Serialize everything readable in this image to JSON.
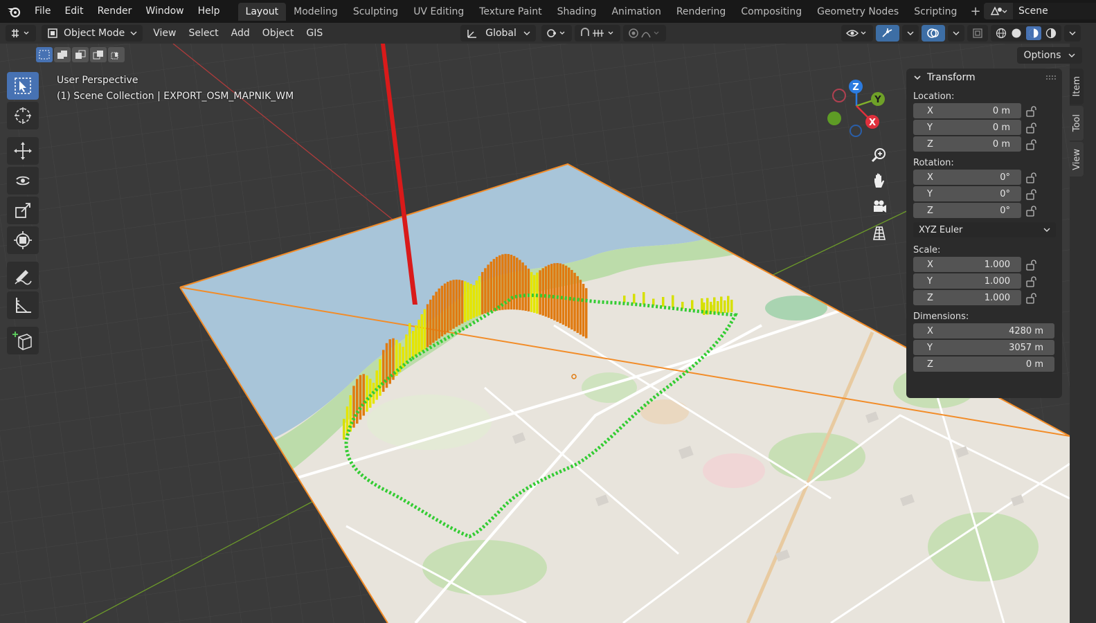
{
  "topbar": {
    "menus": [
      "File",
      "Edit",
      "Render",
      "Window",
      "Help"
    ],
    "workspaces": [
      "Layout",
      "Modeling",
      "Sculpting",
      "UV Editing",
      "Texture Paint",
      "Shading",
      "Animation",
      "Rendering",
      "Compositing",
      "Geometry Nodes",
      "Scripting"
    ],
    "add": "+",
    "scene": "Scene"
  },
  "header": {
    "mode": "Object Mode",
    "menus": [
      "View",
      "Select",
      "Add",
      "Object",
      "GIS"
    ],
    "orientation": "Global"
  },
  "viewport": {
    "title": "User Perspective",
    "collection": "(1) Scene Collection | EXPORT_OSM_MAPNIK_WM",
    "options": "Options",
    "gizmo": {
      "z": "Z",
      "y": "Y",
      "x": "X"
    }
  },
  "npanel": {
    "header": "Transform",
    "location_label": "Location:",
    "location": [
      {
        "axis": "X",
        "value": "0 m"
      },
      {
        "axis": "Y",
        "value": "0 m"
      },
      {
        "axis": "Z",
        "value": "0 m"
      }
    ],
    "rotation_label": "Rotation:",
    "rotation": [
      {
        "axis": "X",
        "value": "0°"
      },
      {
        "axis": "Y",
        "value": "0°"
      },
      {
        "axis": "Z",
        "value": "0°"
      }
    ],
    "rotation_mode": "XYZ Euler",
    "scale_label": "Scale:",
    "scale": [
      {
        "axis": "X",
        "value": "1.000"
      },
      {
        "axis": "Y",
        "value": "1.000"
      },
      {
        "axis": "Z",
        "value": "1.000"
      }
    ],
    "dimensions_label": "Dimensions:",
    "dimensions": [
      {
        "axis": "X",
        "value": "4280 m"
      },
      {
        "axis": "Y",
        "value": "3057 m"
      },
      {
        "axis": "Z",
        "value": "0 m"
      }
    ],
    "tabs": [
      "Item",
      "Tool",
      "View"
    ]
  },
  "colors": {
    "accent": "#4772b3",
    "selection_outline": "#f28c28",
    "track_low": "#33cc33",
    "track_mid": "#e5e500",
    "track_high": "#e07a10"
  }
}
